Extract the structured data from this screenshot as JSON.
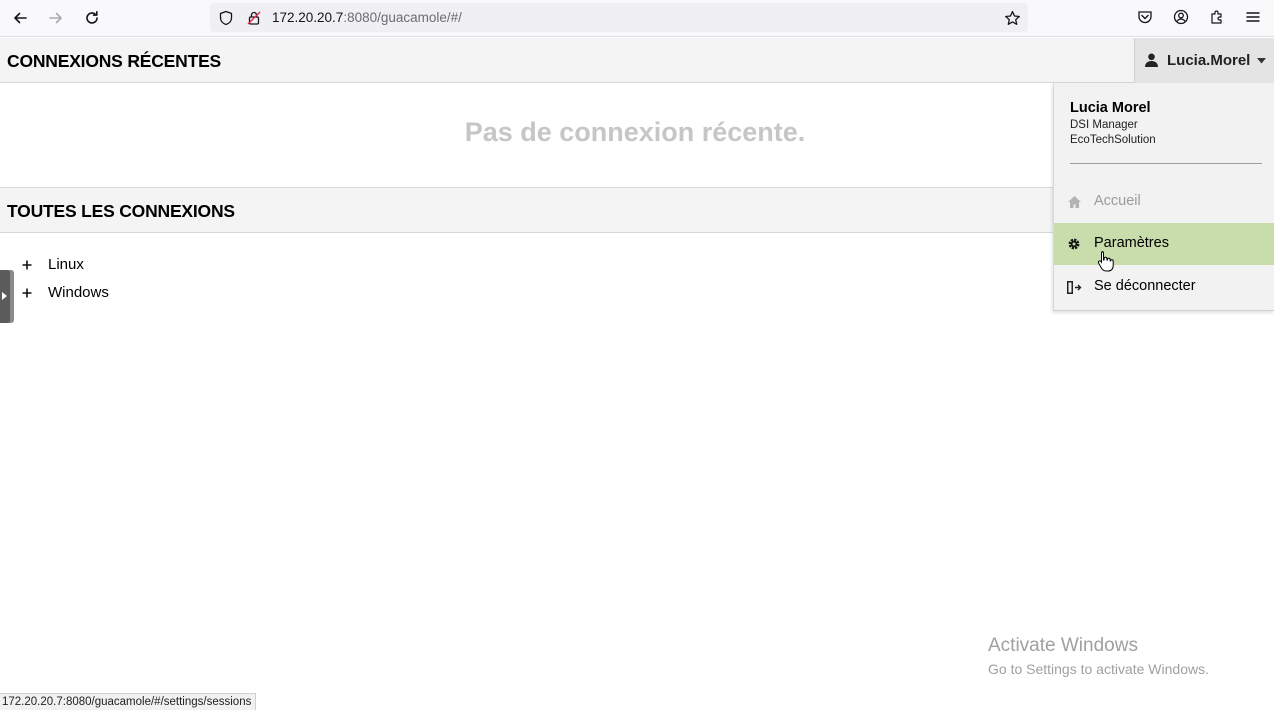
{
  "browser": {
    "url_host": "172.20.20.7",
    "url_rest": ":8080/guacamole/#/"
  },
  "recent": {
    "title": "CONNEXIONS RÉCENTES",
    "empty_message": "Pas de connexion récente."
  },
  "all_connections": {
    "title": "TOUTES LES CONNEXIONS",
    "groups": [
      {
        "label": "Linux"
      },
      {
        "label": "Windows"
      }
    ]
  },
  "user": {
    "username": "Lucia.Morel",
    "full_name": "Lucia Morel",
    "role": "DSI Manager",
    "organization": "EcoTechSolution"
  },
  "menu": {
    "items": [
      {
        "label": "Accueil",
        "icon": "home-icon",
        "state": "disabled"
      },
      {
        "label": "Paramètres",
        "icon": "gear-icon",
        "state": "hovered"
      },
      {
        "label": "Se déconnecter",
        "icon": "logout-icon",
        "state": "normal"
      }
    ]
  },
  "watermark": {
    "title": "Activate Windows",
    "subtitle": "Go to Settings to activate Windows."
  },
  "status_bar": {
    "link": "172.20.20.7:8080/guacamole/#/settings/sessions"
  },
  "colors": {
    "menu_hover": "#c9dcab",
    "header_bg": "#f4f4f4",
    "muted_text": "#c6c6c6"
  }
}
